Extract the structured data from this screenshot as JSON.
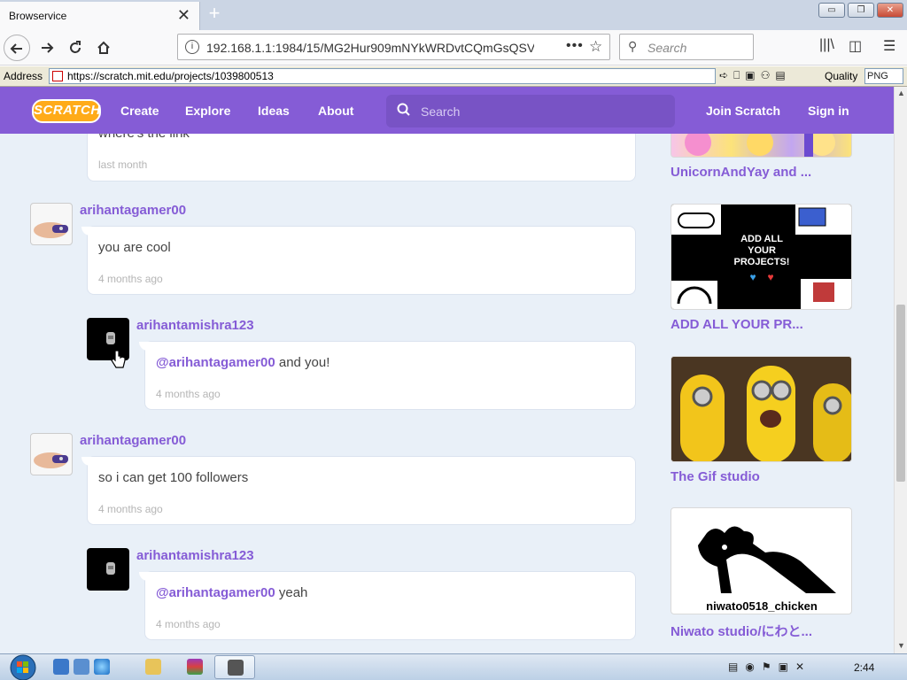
{
  "browser": {
    "tab_title": "Browservice",
    "tab_close": "✕",
    "new_tab": "+",
    "window_buttons": {
      "minimize": "▭",
      "restore": "❐",
      "close": "✕"
    },
    "url": "192.168.1.1:1984/15/MG2Hur909mNYkWRDvtCQmGsQSV",
    "url_more": "•••",
    "search_placeholder": "Search",
    "address_label": "Address",
    "address_url": "https://scratch.mit.edu/projects/1039800513",
    "quality_label": "Quality",
    "quality_value": "PNG"
  },
  "scratch": {
    "logo": "SCRATCH",
    "nav": {
      "create": "Create",
      "explore": "Explore",
      "ideas": "Ideas",
      "about": "About"
    },
    "search_placeholder": "Search",
    "join": "Join Scratch",
    "signin": "Sign in"
  },
  "comments": [
    {
      "user": "",
      "text": "where's the link",
      "time": "last month"
    },
    {
      "user": "arihantagamer00",
      "text": "you are cool",
      "time": "4 months ago"
    },
    {
      "user": "arihantamishra123",
      "mention": "@arihantagamer00",
      "text": " and you!",
      "time": "4 months ago"
    },
    {
      "user": "arihantagamer00",
      "text": "so i can get 100 followers",
      "time": "4 months ago"
    },
    {
      "user": "arihantamishra123",
      "mention": "@arihantagamer00",
      "text": " yeah",
      "time": "4 months ago"
    }
  ],
  "studios": [
    {
      "title": "UnicornAndYay and ..."
    },
    {
      "title": "ADD ALL YOUR PR...",
      "image_text": "ADD ALL YOUR PROJECTS!"
    },
    {
      "title": "The Gif studio"
    },
    {
      "title": "Niwato studio/にわと...",
      "image_text": "niwato0518_chicken"
    }
  ],
  "taskbar": {
    "clock": "2:44"
  }
}
